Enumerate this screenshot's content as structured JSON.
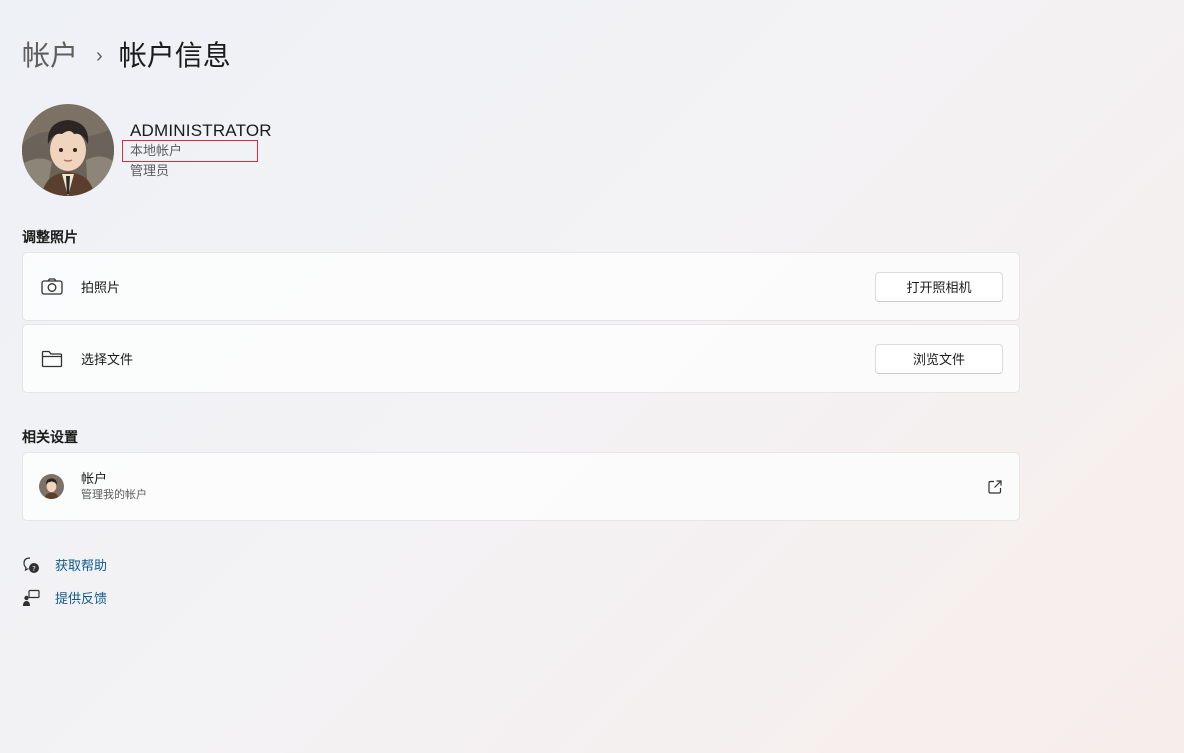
{
  "breadcrumb": {
    "parent": "帐户",
    "separator": "›",
    "current": "帐户信息"
  },
  "profile": {
    "name": "ADMINISTRATOR",
    "account_type": "本地帐户",
    "role": "管理员",
    "avatar_icon": "user-avatar-illustration"
  },
  "adjust_photo": {
    "section_title": "调整照片",
    "take_photo": {
      "label": "拍照片",
      "button": "打开照相机",
      "icon": "camera-icon"
    },
    "choose_file": {
      "label": "选择文件",
      "button": "浏览文件",
      "icon": "folder-icon"
    }
  },
  "related": {
    "section_title": "相关设置",
    "accounts": {
      "title": "帐户",
      "subtitle": "管理我的帐户",
      "icon": "external-link-icon"
    }
  },
  "links": {
    "help": "获取帮助",
    "feedback": "提供反馈"
  },
  "colors": {
    "highlight_border": "#d32f3a",
    "link": "#0f5a8a"
  }
}
